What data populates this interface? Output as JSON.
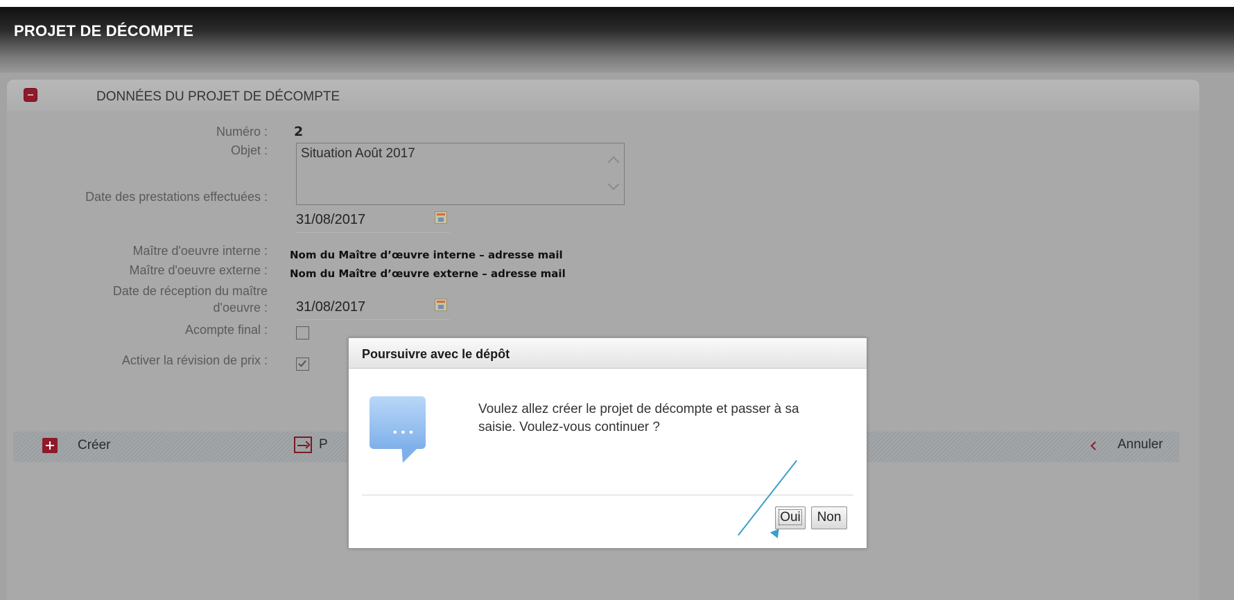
{
  "page": {
    "title": "PROJET DE DÉCOMPTE"
  },
  "section": {
    "title": "DONNÉES DU PROJET DE DÉCOMPTE"
  },
  "form": {
    "numero_label": "Numéro :",
    "numero_value": "2",
    "objet_label": "Objet :",
    "objet_value": "Situation Août 2017",
    "date_prestations_label": "Date des prestations effectuées :",
    "date_prestations_value": "31/08/2017",
    "moe_interne_label": "Maître d'oeuvre interne :",
    "moe_interne_value": "Nom du Maître d’œuvre interne – adresse mail",
    "moe_externe_label": "Maître d'oeuvre externe :",
    "moe_externe_value": "Nom du Maître d’œuvre externe – adresse mail",
    "date_reception_label_line1": "Date de réception du maître",
    "date_reception_label_line2": "d'oeuvre :",
    "date_reception_value": "31/08/2017",
    "acompte_final_label": "Acompte final :",
    "acompte_final_checked": false,
    "revision_prix_label": "Activer la révision de prix :",
    "revision_prix_checked": true
  },
  "actions": {
    "create_label": "Créer",
    "proceed_label_visible": "P",
    "cancel_label": "Annuler"
  },
  "dialog": {
    "title": "Poursuivre avec le dépôt",
    "message": "Voulez allez créer le projet de décompte et passer à sa saisie. Voulez-vous continuer ?",
    "icon": "speech-bubble-icon",
    "yes_label": "Oui",
    "no_label": "Non"
  },
  "colors": {
    "accent": "#8e1a2c",
    "pointer": "#3aa0c9",
    "speech_bubble": "#7fb0ea"
  }
}
